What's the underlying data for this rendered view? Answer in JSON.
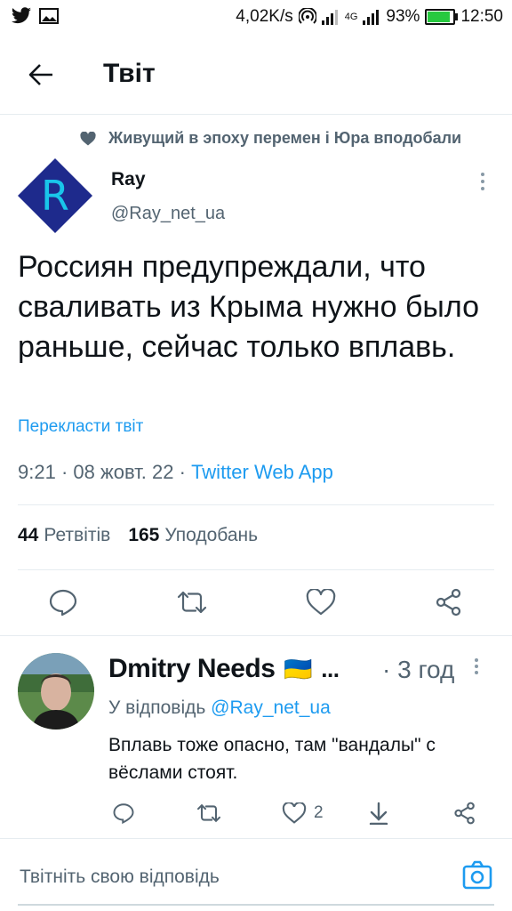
{
  "status_bar": {
    "speed": "4,02K/s",
    "network": "4G",
    "battery": "93%",
    "battery_level": 0.93,
    "time": "12:50",
    "icons": [
      "twitter-icon",
      "image-icon",
      "hotspot-icon",
      "signal-icon",
      "battery-icon"
    ]
  },
  "header": {
    "title": "Твіт"
  },
  "social_context": {
    "text": "Живущий в эпоху перемен і Юра вподобали",
    "icon": "heart-icon"
  },
  "tweet": {
    "avatar_letter": "R",
    "name": "Ray",
    "handle": "@Ray_net_ua",
    "text": "Россиян предупреждали, что сваливать из Крыма нужно было раньше, сейчас только вплавь.",
    "translate": "Перекласти твіт",
    "time": "9:21",
    "date": "08 жовт. 22",
    "source": "Twitter Web App",
    "retweets_count": "44",
    "retweets_label": "Ретвітів",
    "likes_count": "165",
    "likes_label": "Уподобань"
  },
  "reply": {
    "name": "Dmitry Needs",
    "flag": "🇺🇦",
    "ellipsis": "...",
    "time": "· 3 год",
    "reply_to_label": "У відповідь",
    "reply_to_handle": "@Ray_net_ua",
    "text": "Вплавь тоже опасно, там \"вандалы\" с вёслами стоят.",
    "likes": "2"
  },
  "composer": {
    "placeholder": "Твітніть свою відповідь"
  },
  "colors": {
    "accent": "#1d9bf0",
    "avatar_bg": "#1e2a8c",
    "avatar_letter": "#19c6ea",
    "muted": "#536471"
  }
}
